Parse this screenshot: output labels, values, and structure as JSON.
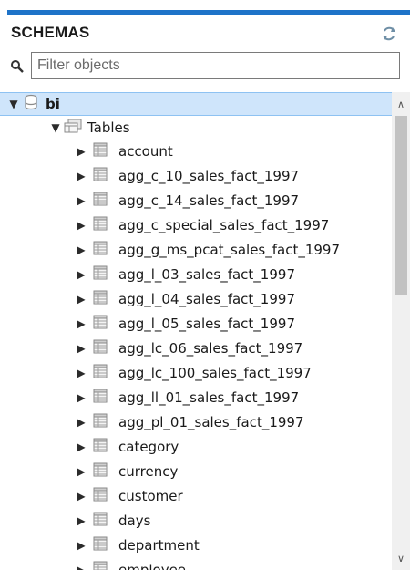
{
  "header": {
    "title": "SCHEMAS",
    "refresh_icon": "refresh-icon"
  },
  "search": {
    "placeholder": "Filter objects",
    "value": ""
  },
  "tree": {
    "schema": {
      "name": "bi",
      "expanded": true,
      "selected": true,
      "icon": "database-icon"
    },
    "group": {
      "name": "Tables",
      "expanded": true,
      "icon": "tables-folder-icon"
    },
    "tables": [
      "account",
      "agg_c_10_sales_fact_1997",
      "agg_c_14_sales_fact_1997",
      "agg_c_special_sales_fact_1997",
      "agg_g_ms_pcat_sales_fact_1997",
      "agg_l_03_sales_fact_1997",
      "agg_l_04_sales_fact_1997",
      "agg_l_05_sales_fact_1997",
      "agg_lc_06_sales_fact_1997",
      "agg_lc_100_sales_fact_1997",
      "agg_ll_01_sales_fact_1997",
      "agg_pl_01_sales_fact_1997",
      "category",
      "currency",
      "customer",
      "days",
      "department",
      "employee"
    ]
  },
  "colors": {
    "accent": "#1e73c8",
    "selection": "#cfe5fb"
  }
}
